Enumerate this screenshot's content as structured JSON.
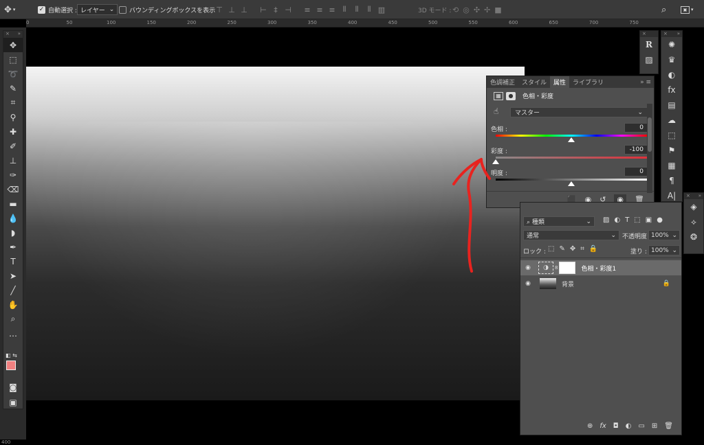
{
  "options_bar": {
    "auto_select_label": "自動選択 :",
    "auto_select_checked": true,
    "auto_select_target": "レイヤー",
    "bounding_box_label": "バウンディングボックスを表示",
    "mode_3d_label": "3D モード :"
  },
  "ruler": {
    "top_ticks": [
      "0",
      "50",
      "100",
      "150",
      "200",
      "250",
      "300",
      "350",
      "400",
      "450",
      "500",
      "550",
      "600",
      "650",
      "700",
      "750"
    ],
    "left_tick": "400"
  },
  "toolbox": {
    "tools": [
      "move",
      "marquee",
      "lasso",
      "quick-select",
      "crop",
      "eyedropper",
      "healing",
      "brush",
      "stamp",
      "history-brush",
      "eraser",
      "gradient",
      "blur",
      "dodge",
      "pen",
      "type",
      "path-select",
      "line",
      "hand",
      "zoom",
      "more"
    ],
    "foreground_color": "#f08080",
    "background_color": "#ffffff"
  },
  "properties_panel": {
    "tabs": [
      "色調補正",
      "スタイル",
      "属性",
      "ライブラリ"
    ],
    "active_tab": "属性",
    "adjustment_name": "色相・彩度",
    "preset": "マスター",
    "hue_label": "色相 :",
    "hue_value": "0",
    "saturation_label": "彩度 :",
    "saturation_value": "-100",
    "lightness_label": "明度 :",
    "lightness_value": "0"
  },
  "layers_panel": {
    "filter_label": "種類",
    "blend_mode": "通常",
    "opacity_label": "不透明度 :",
    "opacity_value": "100%",
    "lock_label": "ロック :",
    "fill_label": "塗り :",
    "fill_value": "100%",
    "layers": [
      {
        "name": "色相・彩度1",
        "visible": true,
        "selected": true
      },
      {
        "name": "背景",
        "visible": true,
        "locked": true
      }
    ]
  },
  "annotation_color": "#e8231f"
}
